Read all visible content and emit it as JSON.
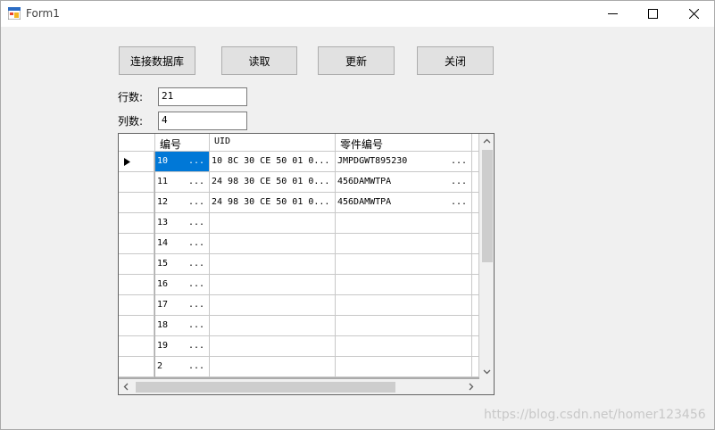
{
  "window": {
    "title": "Form1"
  },
  "buttons": {
    "connect": "连接数据库",
    "read": "读取",
    "update": "更新",
    "close": "关闭"
  },
  "fields": {
    "rows_label": "行数:",
    "rows_value": "21",
    "cols_label": "列数:",
    "cols_value": "4"
  },
  "grid": {
    "columns": [
      "编号",
      "UID",
      "零件编号"
    ],
    "rows": [
      {
        "id": "10",
        "uid": "10 8C 30 CE 50 01 0...",
        "part": "JMPDGWT895230",
        "selected": true
      },
      {
        "id": "11",
        "uid": "24 98 30 CE 50 01 0...",
        "part": "456DAMWTPA"
      },
      {
        "id": "12",
        "uid": "24 98 30 CE 50 01 0...",
        "part": "456DAMWTPA"
      },
      {
        "id": "13",
        "uid": "",
        "part": ""
      },
      {
        "id": "14",
        "uid": "",
        "part": ""
      },
      {
        "id": "15",
        "uid": "",
        "part": ""
      },
      {
        "id": "16",
        "uid": "",
        "part": ""
      },
      {
        "id": "17",
        "uid": "",
        "part": ""
      },
      {
        "id": "18",
        "uid": "",
        "part": ""
      },
      {
        "id": "19",
        "uid": "",
        "part": ""
      },
      {
        "id": "2",
        "uid": "",
        "part": ""
      }
    ],
    "ellipsis": "..."
  },
  "watermark": "https://blog.csdn.net/homer123456",
  "icons": {
    "app": "form-app-icon",
    "minimize": "minimize-icon",
    "maximize": "maximize-icon",
    "close": "close-icon",
    "current_row": "row-pointer-icon",
    "scroll_up": "chevron-up-icon",
    "scroll_down": "chevron-down-icon",
    "scroll_left": "chevron-left-icon",
    "scroll_right": "chevron-right-icon"
  },
  "colors": {
    "selection": "#0078d7",
    "titlebar": "#ffffff",
    "form": "#f0f0f0"
  }
}
